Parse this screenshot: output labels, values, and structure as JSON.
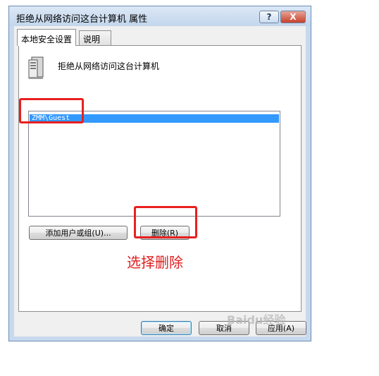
{
  "window": {
    "title": "拒绝从网络访问这台计算机 属性",
    "help_label": "?",
    "close_label": "X"
  },
  "tabs": [
    {
      "label": "本地安全设置"
    },
    {
      "label": "说明"
    }
  ],
  "policy": {
    "title": "拒绝从网络访问这台计算机",
    "icon": "server-icon"
  },
  "list": {
    "items": [
      "ZMM\\Guest"
    ]
  },
  "buttons": {
    "add": "添加用户或组(U)...",
    "remove": "删除(R)",
    "ok": "确定",
    "cancel": "取消",
    "apply": "应用(A)"
  },
  "annotation": {
    "text": "选择删除",
    "color": "#e02020"
  },
  "watermark": {
    "text": "Baidu经验"
  },
  "colors": {
    "selection": "#3399ff",
    "annotation_box": "#e82020"
  }
}
